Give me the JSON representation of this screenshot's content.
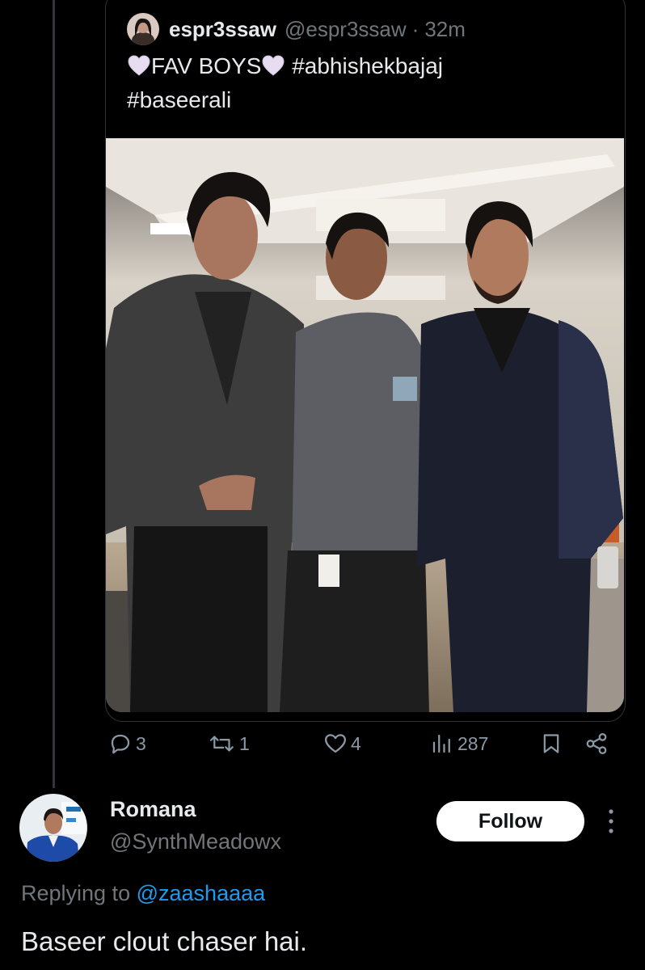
{
  "quoted_tweet": {
    "display_name": "espr3ssaw",
    "handle": "@espr3ssaw",
    "separator": "·",
    "time": "32m",
    "text": {
      "fav_boys": "FAV BOYS",
      "hashtag1": "#abhishekbajaj",
      "hashtag2": "#baseerali"
    },
    "heart_icon_color": "#e8dcf0"
  },
  "actions": {
    "replies": "3",
    "retweets": "1",
    "likes": "4",
    "views": "287",
    "icon_color": "#8b98a5"
  },
  "reply": {
    "display_name": "Romana",
    "handle": "@SynthMeadowx",
    "follow_label": "Follow",
    "replying_prefix": "Replying to",
    "replying_to": "@zaashaaaa",
    "text": "Baseer clout chaser hai.",
    "mention_color": "#1d9bf0"
  }
}
